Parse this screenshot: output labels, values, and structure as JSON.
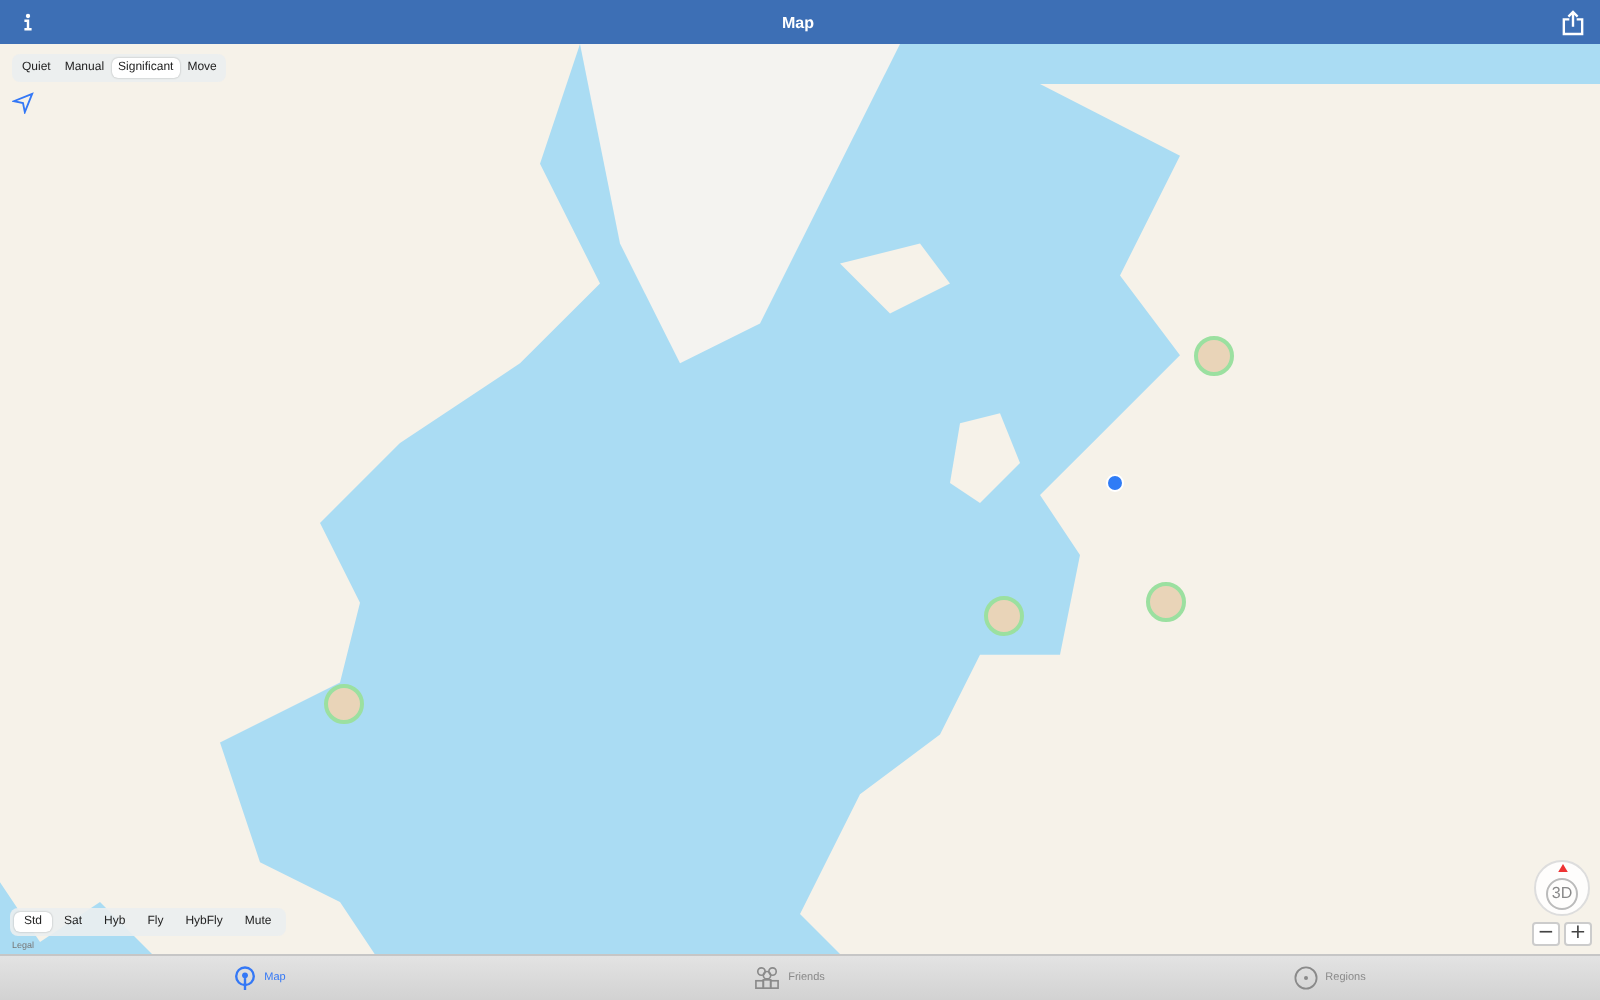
{
  "window": {
    "title": "Map"
  },
  "tracking_modes": [
    {
      "label": "Quiet",
      "selected": false
    },
    {
      "label": "Manual",
      "selected": false
    },
    {
      "label": "Significant",
      "selected": true
    },
    {
      "label": "Move",
      "selected": false
    }
  ],
  "map_types": [
    {
      "label": "Std",
      "selected": true
    },
    {
      "label": "Sat",
      "selected": false
    },
    {
      "label": "Hyb",
      "selected": false
    },
    {
      "label": "Fly",
      "selected": false
    },
    {
      "label": "HybFly",
      "selected": false
    },
    {
      "label": "Mute",
      "selected": false
    }
  ],
  "legal": "Legal",
  "compass": {
    "label": "3D"
  },
  "zoom": {
    "out": "−",
    "in": "+"
  },
  "tabs": [
    {
      "label": "Map",
      "kind": "pin",
      "selected": true
    },
    {
      "label": "Friends",
      "kind": "people",
      "selected": false
    },
    {
      "label": "Regions",
      "kind": "circle",
      "selected": false
    }
  ]
}
